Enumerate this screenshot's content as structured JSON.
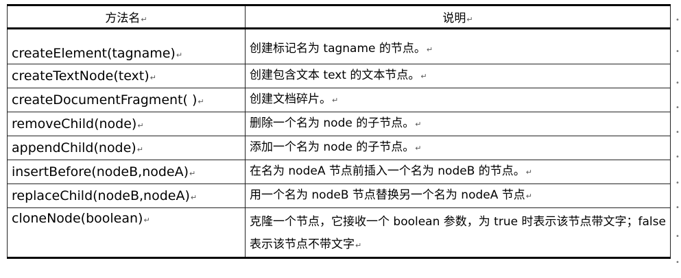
{
  "header": {
    "method": "方法名",
    "description": "说明"
  },
  "paragraph_mark": "↵",
  "rows": [
    {
      "method": "createElement(tagname)",
      "description": "创建标记名为 tagname 的节点。"
    },
    {
      "method": "createTextNode(text)",
      "description": "创建包含文本 text 的文本节点。"
    },
    {
      "method": "createDocumentFragment( )",
      "description": "创建文档碎片。"
    },
    {
      "method": "removeChild(node)",
      "description": "删除一个名为 node 的子节点。"
    },
    {
      "method": "appendChild(node)",
      "description": "添加一个名为 node 的子节点。"
    },
    {
      "method": "insertBefore(nodeB,nodeA)",
      "description": "在名为 nodeA 节点前插入一个名为 nodeB 的节点。"
    },
    {
      "method": "replaceChild(nodeB,nodeA)",
      "description": "用一个名为 nodeB 节点替换另一个名为 nodeA 节点"
    },
    {
      "method": "cloneNode(boolean)",
      "description": "克隆一个节点，它接收一个 boolean 参数，为 true 时表示该节点带文字；false 表示该节点不带文字"
    }
  ],
  "row_end_mark": "•"
}
